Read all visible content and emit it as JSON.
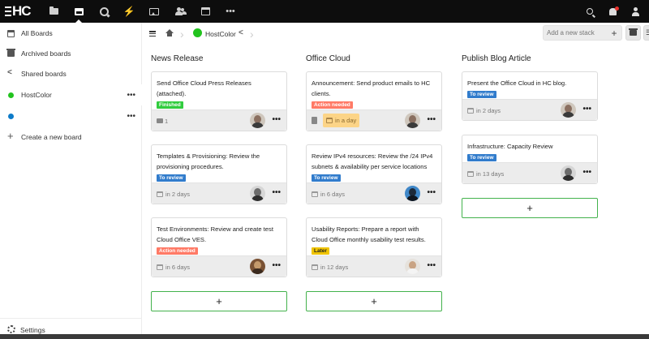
{
  "app": {
    "logo_text": "HC",
    "nav_apps": [
      {
        "icon": "files-icon"
      },
      {
        "icon": "deck-icon"
      },
      {
        "icon": "talk-icon"
      },
      {
        "icon": "activity-icon"
      },
      {
        "icon": "gallery-icon"
      },
      {
        "icon": "contacts-icon"
      },
      {
        "icon": "calendar-icon"
      },
      {
        "icon": "more-apps-icon",
        "glyph": "•••"
      }
    ],
    "right_icons": [
      "search-icon",
      "notifications-icon",
      "user-menu-icon"
    ]
  },
  "sidebar": {
    "items": [
      {
        "label": "All Boards",
        "icon": "boards-icon"
      },
      {
        "label": "Archived boards",
        "icon": "archive-icon"
      },
      {
        "label": "Shared boards",
        "icon": "share-icon"
      },
      {
        "label": "HostColor",
        "color": "#22c31e",
        "menu": "•••"
      },
      {
        "label": "",
        "color": "#0d7bc9",
        "menu": "•••"
      },
      {
        "label": "Create a new board",
        "icon": "plus-icon",
        "glyph": "+"
      }
    ],
    "settings_label": "Settings"
  },
  "board": {
    "title": "HostColor",
    "color": "#22c31e",
    "add_stack_placeholder": "Add a new stack",
    "add_stack_glyph": "+",
    "filter_glyph": "☰"
  },
  "tag_colors": {
    "Finished": "#31cc3e",
    "To review": "#317ccc",
    "Action needed": "#ff7a66",
    "Later": "#f0c400"
  },
  "stacks": [
    {
      "title": "News Release",
      "cards": [
        {
          "title": "Send Office Cloud Press Releases (attached).",
          "tag": "Finished",
          "attachments": "1"
        },
        {
          "title": "Templates & Provisioning: Review the provisioning procedures.",
          "tag": "To review",
          "due": "in 2 days"
        },
        {
          "title": "Test Environments: Review and create test Cloud Office VES.",
          "tag": "Action needed",
          "due": "in 6 days"
        }
      ],
      "add_glyph": "+"
    },
    {
      "title": "Office Cloud",
      "cards": [
        {
          "title": "Announcement: Send product emails to HC clients.",
          "tag": "Action needed",
          "due": "in a day"
        },
        {
          "title": "Review IPv4 resources: Review the /24 IPv4 subnets & availability per service locations",
          "tag": "To review",
          "due": "in 6 days"
        },
        {
          "title": "Usability Reports: Prepare a report with Cloud Office monthly usability test results.",
          "tag": "Later",
          "due": "in 12 days"
        }
      ],
      "add_glyph": "+"
    },
    {
      "title": "Publish Blog Article",
      "cards": [
        {
          "title": "Present the Office Cloud in HC blog.",
          "tag": "To review",
          "due": "in 2 days"
        },
        {
          "title": "Infrastructure: Capacity Review",
          "tag": "To review",
          "due": "in 13 days"
        }
      ],
      "add_glyph": "+"
    }
  ],
  "card_menu_glyph": "•••"
}
